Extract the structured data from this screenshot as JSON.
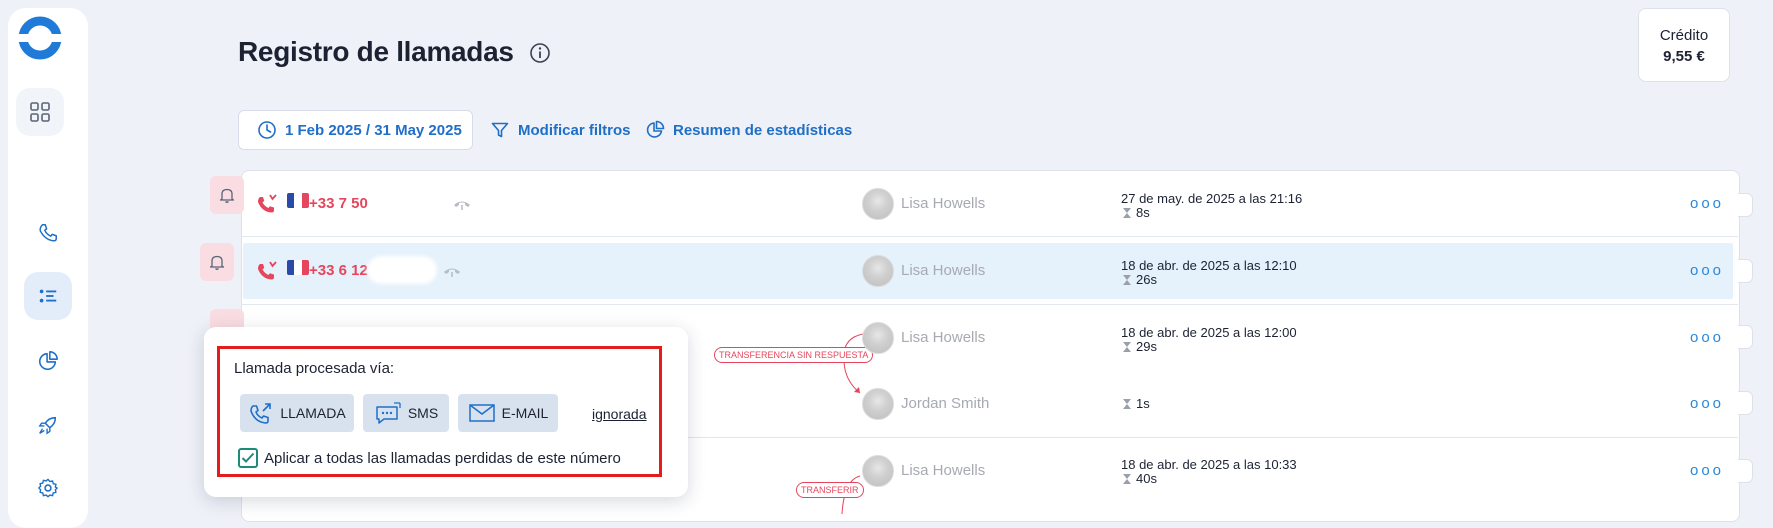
{
  "header": {
    "title": "Registro de llamadas",
    "credit_label": "Crédito",
    "credit_value": "9,55 €"
  },
  "filters": {
    "date_range": "1 Feb 2025 / 31 May 2025",
    "modify_label": "Modificar filtros",
    "stats_label": "Resumen de estadísticas"
  },
  "calls": [
    {
      "number": "+33 7 50",
      "agent": "Lisa Howells",
      "datetime": "27 de may. de 2025 a las 21:16",
      "duration": "8s"
    },
    {
      "number": "+33 6 12",
      "agent": "Lisa Howells",
      "datetime": "18 de abr. de 2025 a las 12:10",
      "duration": "26s"
    },
    {
      "number": "",
      "agent": "Lisa Howells",
      "datetime": "18 de abr. de 2025 a las 12:00",
      "duration": "29s",
      "tag": "TRANSFERENCIA SIN RESPUESTA"
    },
    {
      "number": "",
      "agent": "Jordan Smith",
      "datetime": "",
      "duration": "1s"
    },
    {
      "number": "",
      "agent": "Lisa Howells",
      "datetime": "18 de abr. de 2025 a las 10:33",
      "duration": "40s",
      "tag": "TRANSFERIR"
    }
  ],
  "more_label": "ooo",
  "popup": {
    "title": "Llamada procesada vía:",
    "call_button": "LLAMADA",
    "sms_button": "SMS",
    "email_button": "E-MAIL",
    "ignore_link": "ignorada",
    "apply_all_label": "Aplicar a todas las llamadas perdidas de este número",
    "apply_all_checked": true
  },
  "colors": {
    "accent": "#1f6fc8",
    "missed": "#e5465d",
    "highlight_box": "#e31d1d",
    "row_selected": "#e5f1fb"
  },
  "icons": {
    "logo": "ring-logo-icon",
    "nav": [
      "grid-icon",
      "phone-icon",
      "list-icon",
      "pie-chart-icon",
      "rocket-icon",
      "gear-icon"
    ]
  }
}
